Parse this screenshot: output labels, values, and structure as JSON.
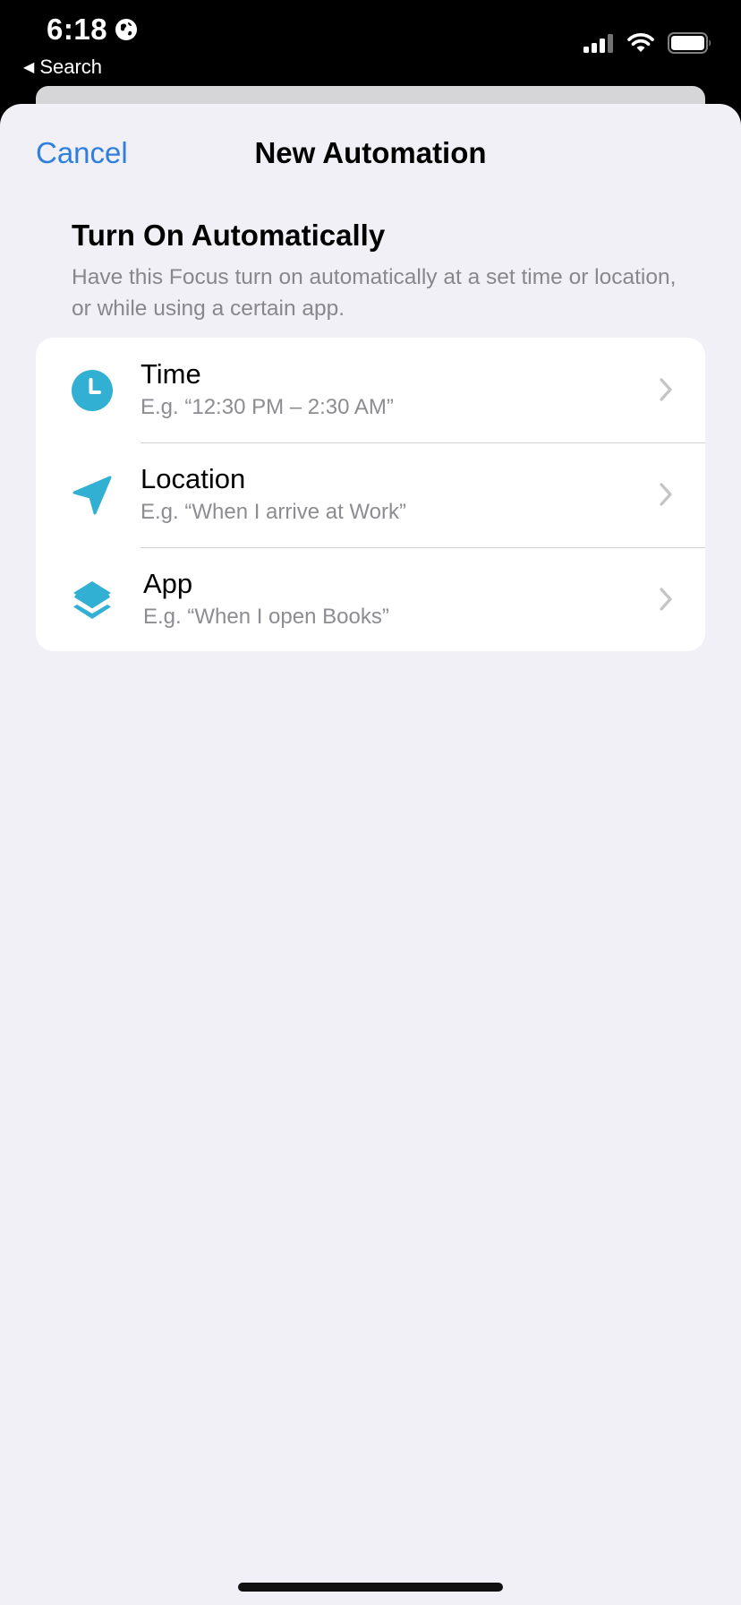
{
  "status_bar": {
    "time": "6:18",
    "back_label": "Search"
  },
  "nav": {
    "cancel_label": "Cancel",
    "title": "New Automation"
  },
  "section": {
    "title": "Turn On Automatically",
    "description": "Have this Focus turn on automatically at a set time or location, or while using a certain app."
  },
  "options": [
    {
      "icon": "clock-icon",
      "title": "Time",
      "subtitle": "E.g. “12:30 PM – 2:30 AM”"
    },
    {
      "icon": "location-arrow-icon",
      "title": "Location",
      "subtitle": "E.g. “When I arrive at Work”"
    },
    {
      "icon": "app-stack-icon",
      "title": "App",
      "subtitle": "E.g. “When I open Books”"
    }
  ],
  "colors": {
    "accent": "#2f7fdd",
    "icon_teal": "#31b0d3",
    "sheet_background": "#f1f0f6",
    "secondary_text": "#8d8c91"
  }
}
